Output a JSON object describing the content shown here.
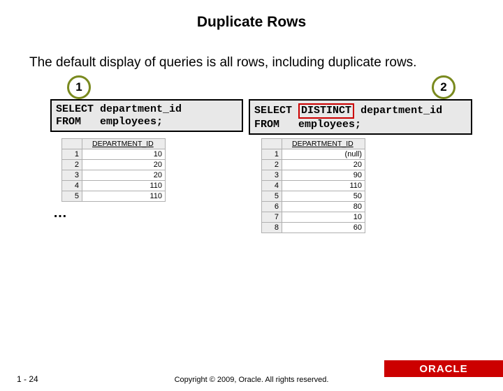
{
  "title": "Duplicate Rows",
  "body_text": "The default display of queries is all rows, including duplicate rows.",
  "badges": {
    "one": "1",
    "two": "2"
  },
  "code1": {
    "line1": "SELECT department_id",
    "line2": "FROM   employees;"
  },
  "code2": {
    "kw_select": "SELECT",
    "kw_distinct": "DISTINCT",
    "rest1": "department_id",
    "line2": "FROM   employees;"
  },
  "result_header": "DEPARTMENT_ID",
  "result1": [
    {
      "n": "1",
      "v": "10"
    },
    {
      "n": "2",
      "v": "20"
    },
    {
      "n": "3",
      "v": "20"
    },
    {
      "n": "4",
      "v": "110"
    },
    {
      "n": "5",
      "v": "110"
    }
  ],
  "result2": [
    {
      "n": "1",
      "v": "(null)"
    },
    {
      "n": "2",
      "v": "20"
    },
    {
      "n": "3",
      "v": "90"
    },
    {
      "n": "4",
      "v": "110"
    },
    {
      "n": "5",
      "v": "50"
    },
    {
      "n": "6",
      "v": "80"
    },
    {
      "n": "7",
      "v": "10"
    },
    {
      "n": "8",
      "v": "60"
    }
  ],
  "ellipsis": "…",
  "footer": {
    "page": "1 - 24",
    "copyright": "Copyright © 2009, Oracle. All rights reserved.",
    "logo": "ORACLE"
  }
}
